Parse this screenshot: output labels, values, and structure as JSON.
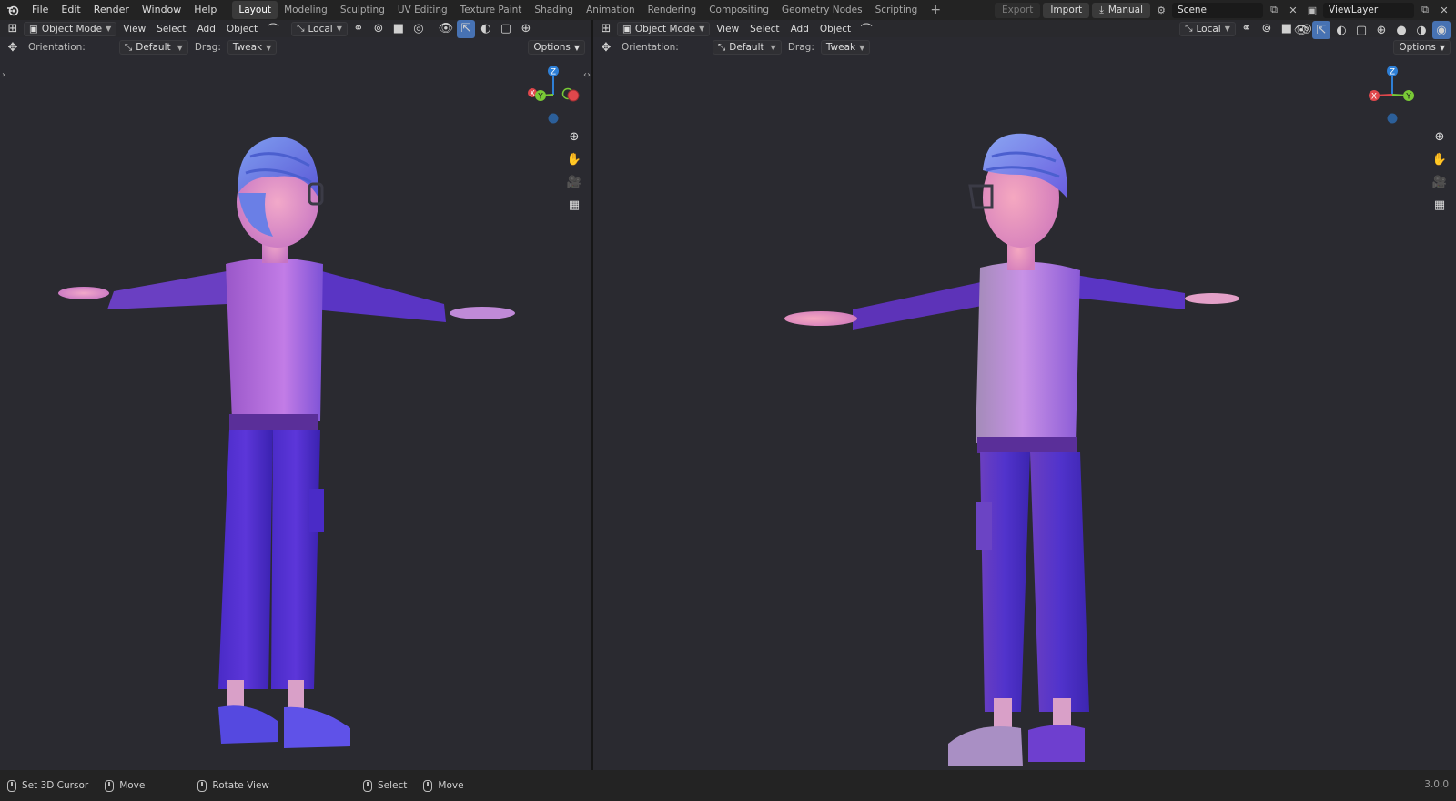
{
  "topbar": {
    "menus": [
      "File",
      "Edit",
      "Render",
      "Window",
      "Help"
    ],
    "workspaces": [
      "Layout",
      "Modeling",
      "Sculpting",
      "UV Editing",
      "Texture Paint",
      "Shading",
      "Animation",
      "Rendering",
      "Compositing",
      "Geometry Nodes",
      "Scripting"
    ],
    "active_workspace": "Layout",
    "add_workspace": "+",
    "export_label": "Export",
    "import_label": "Import",
    "manual_label": "Manual",
    "scene_name": "Scene",
    "view_layer": "ViewLayer"
  },
  "viewport_left": {
    "mode": "Object Mode",
    "menus": [
      "View",
      "Select",
      "Add",
      "Object"
    ],
    "transform_orientation": "Local",
    "orientation_label": "Orientation:",
    "orientation_value": "Default",
    "drag_label": "Drag:",
    "drag_value": "Tweak",
    "options_label": "Options",
    "gizmo": {
      "z": "Z",
      "y": "Y",
      "x": "X"
    }
  },
  "viewport_right": {
    "mode": "Object Mode",
    "menus": [
      "View",
      "Select",
      "Add",
      "Object"
    ],
    "transform_orientation": "Local",
    "orientation_label": "Orientation:",
    "orientation_value": "Default",
    "drag_label": "Drag:",
    "drag_value": "Tweak",
    "options_label": "Options",
    "gizmo": {
      "z": "Z",
      "y": "Y",
      "x": "X"
    }
  },
  "status": {
    "items": [
      {
        "icon": "mouse-left-icon",
        "label": "Set 3D Cursor"
      },
      {
        "icon": "mouse-middle-icon",
        "label": "Move"
      },
      {
        "icon": "mouse-right-icon",
        "label": "Rotate View"
      },
      {
        "icon": "mouse-left-icon",
        "label": "Select"
      },
      {
        "icon": "mouse-middle-icon",
        "label": "Move"
      }
    ],
    "version": "3.0.0"
  },
  "colors": {
    "accent": "#4772b3",
    "axis_x": "#e0474c",
    "axis_y": "#79c936",
    "axis_z": "#2e7fd6"
  }
}
